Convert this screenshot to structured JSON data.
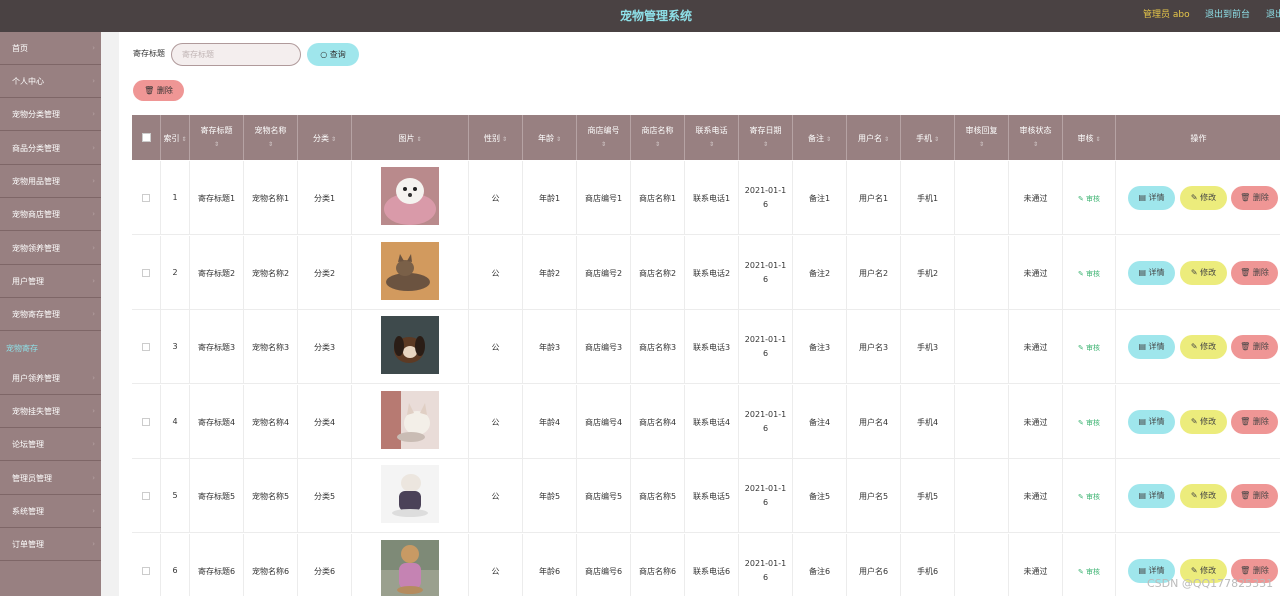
{
  "header": {
    "title": "宠物管理系统",
    "admin": "管理员 abo",
    "exit_front": "退出到前台",
    "exit_system": "退出"
  },
  "sidebar": {
    "items": [
      {
        "label": "首页"
      },
      {
        "label": "个人中心"
      },
      {
        "label": "宠物分类管理"
      },
      {
        "label": "商品分类管理"
      },
      {
        "label": "宠物用品管理"
      },
      {
        "label": "宠物商店管理"
      },
      {
        "label": "宠物领养管理"
      },
      {
        "label": "用户管理"
      },
      {
        "label": "宠物寄存管理"
      },
      {
        "label": "宠物寄存",
        "active": true
      },
      {
        "label": "用户领养管理"
      },
      {
        "label": "宠物挂失管理"
      },
      {
        "label": "论坛管理"
      },
      {
        "label": "管理员管理"
      },
      {
        "label": "系统管理"
      },
      {
        "label": "订单管理"
      }
    ]
  },
  "search": {
    "label": "寄存标题",
    "placeholder": "寄存标题",
    "query_button": "查询",
    "query_icon": "search-icon"
  },
  "toolbar": {
    "delete_label": "删除",
    "delete_icon": "trash-icon"
  },
  "table": {
    "columns": [
      "索引",
      "寄存标题",
      "宠物名称",
      "分类",
      "图片",
      "性别",
      "年龄",
      "商店编号",
      "商店名称",
      "联系电话",
      "寄存日期",
      "备注",
      "用户名",
      "手机",
      "审核回复",
      "审核状态",
      "审核",
      "操作"
    ],
    "audit_action": "审核",
    "actions": {
      "detail": "详情",
      "edit": "修改",
      "delete": "删除"
    },
    "rows": [
      {
        "index": "1",
        "title": "寄存标题1",
        "pet": "宠物名称1",
        "category": "分类1",
        "image": "white-puppy-photo",
        "gender": "公",
        "age": "年龄1",
        "shop_no": "商店编号1",
        "shop_name": "商店名称1",
        "phone": "联系电话1",
        "date": "2021-01-16",
        "note": "备注1",
        "user": "用户名1",
        "mobile": "手机1",
        "reply": "",
        "status": "未通过"
      },
      {
        "index": "2",
        "title": "寄存标题2",
        "pet": "宠物名称2",
        "category": "分类2",
        "image": "tabby-cat-photo",
        "gender": "公",
        "age": "年龄2",
        "shop_no": "商店编号2",
        "shop_name": "商店名称2",
        "phone": "联系电话2",
        "date": "2021-01-16",
        "note": "备注2",
        "user": "用户名2",
        "mobile": "手机2",
        "reply": "",
        "status": "未通过"
      },
      {
        "index": "3",
        "title": "寄存标题3",
        "pet": "宠物名称3",
        "category": "分类3",
        "image": "dark-puppy-photo",
        "gender": "公",
        "age": "年龄3",
        "shop_no": "商店编号3",
        "shop_name": "商店名称3",
        "phone": "联系电话3",
        "date": "2021-01-16",
        "note": "备注3",
        "user": "用户名3",
        "mobile": "手机3",
        "reply": "",
        "status": "未通过"
      },
      {
        "index": "4",
        "title": "寄存标题4",
        "pet": "宠物名称4",
        "category": "分类4",
        "image": "kitten-photo",
        "gender": "公",
        "age": "年龄4",
        "shop_no": "商店编号4",
        "shop_name": "商店名称4",
        "phone": "联系电话4",
        "date": "2021-01-16",
        "note": "备注4",
        "user": "用户名4",
        "mobile": "手机4",
        "reply": "",
        "status": "未通过"
      },
      {
        "index": "5",
        "title": "寄存标题5",
        "pet": "宠物名称5",
        "category": "分类5",
        "image": "dressed-dog-photo",
        "gender": "公",
        "age": "年龄5",
        "shop_no": "商店编号5",
        "shop_name": "商店名称5",
        "phone": "联系电话5",
        "date": "2021-01-16",
        "note": "备注5",
        "user": "用户名5",
        "mobile": "手机5",
        "reply": "",
        "status": "未通过"
      },
      {
        "index": "6",
        "title": "寄存标题6",
        "pet": "宠物名称6",
        "category": "分类6",
        "image": "poodle-outdoor-photo",
        "gender": "公",
        "age": "年龄6",
        "shop_no": "商店编号6",
        "shop_name": "商店名称6",
        "phone": "联系电话6",
        "date": "2021-01-16",
        "note": "备注6",
        "user": "用户名6",
        "mobile": "手机6",
        "reply": "",
        "status": "未通过"
      }
    ]
  },
  "watermark": "CSDN @QQ177825331",
  "colors": {
    "topbar": "#4a4243",
    "sidebar": "#988081",
    "accent_cyan": "#9fe6ec",
    "accent_yellow": "#ecec7c",
    "accent_red": "#ef9695",
    "audit_green": "#3cb371"
  }
}
